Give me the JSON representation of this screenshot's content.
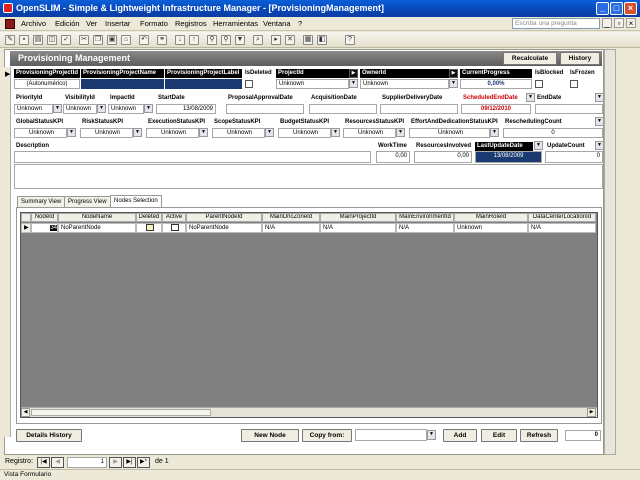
{
  "window": {
    "title": "OpenSLIM - Simple & Lightweight Infrastructure Manager - [ProvisioningManagement]"
  },
  "menu": [
    "Archivo",
    "Edición",
    "Ver",
    "Insertar",
    "Formato",
    "Registros",
    "Herramientas",
    "Ventana",
    "?"
  ],
  "ask": {
    "placeholder": "Escriba una pregunta"
  },
  "form": {
    "title": "Provisioning Management",
    "recalculate": "Recalculate",
    "history": "History",
    "row1": {
      "labels": [
        "ProvisioningProjectId",
        "ProvisioningProjectName",
        "ProvisioningProjectLabel",
        "IsDeleted",
        "ProjectId",
        "OwnerId",
        "CurrentProgress",
        "IsBlocked",
        "IsFrozen"
      ],
      "project_id": "(Autonumérico)",
      "project": "Unknown",
      "owner": "Unknown",
      "progress": "0,00%"
    },
    "row2": {
      "labels": [
        "PriorityId",
        "VisibilityId",
        "ImpactId",
        "StartDate",
        "ProposalApprovalDate",
        "AcquisitionDate",
        "SupplierDeliveryDate",
        "ScheduledEndDate",
        "EndDate"
      ],
      "priority": "Unknown",
      "visibility": "Unknown",
      "impact": "Unknown",
      "start_date": "13/08/2009",
      "scheduled_end": "09/12/2010"
    },
    "row3": {
      "labels": [
        "GlobalStatusKPI",
        "RiskStatusKPI",
        "ExecutionStatusKPI",
        "ScopeStatusKPI",
        "BudgetStatusKPI",
        "ResourcesStatusKPI",
        "EffortAndDedicationStatusKPI",
        "ReschedulingCount"
      ],
      "values": [
        "Unknown",
        "Unknown",
        "Unknown",
        "Unknown",
        "Unknown",
        "Unknown",
        "Unknown"
      ],
      "rescheduling": "0"
    },
    "row4": {
      "labels": [
        "Description",
        "WorkTime",
        "ResourcesInvolved",
        "LastUpdateDate",
        "UpdateCount"
      ],
      "worktime": "0,00",
      "resources": "0,00",
      "last_update": "13/08/2009",
      "update_count": "0"
    }
  },
  "tabs": [
    "Summary View",
    "Progress View",
    "Nodes Selection"
  ],
  "grid": {
    "headers": [
      "NodeId",
      "NodeName",
      "Deleted",
      "Active",
      "ParentNodeId",
      "MainDncZoneId",
      "MainProjectId",
      "MainEnvironmentId",
      "MainRoleId",
      "DataCenterLocationId"
    ],
    "row": [
      "34",
      "NoParentNode",
      "",
      "",
      "NoParentNode",
      "N/A",
      "N/A",
      "N/A",
      "Unknown",
      "N/A"
    ]
  },
  "bottom": {
    "details_history": "Details History",
    "new_node": "New Node",
    "copy_from": "Copy from:",
    "add": "Add",
    "edit": "Edit",
    "refresh": "Refresh",
    "count": "0"
  },
  "navigation": {
    "label": "Registro:",
    "current": "1",
    "total_label": "de 1"
  },
  "status": {
    "text": "Vista Formulario"
  },
  "colors": {
    "title_bar": "#0a5fd8",
    "header_bar": "#5c5c5c",
    "subform_bg": "#808080",
    "highlight": "#1b3a72"
  }
}
